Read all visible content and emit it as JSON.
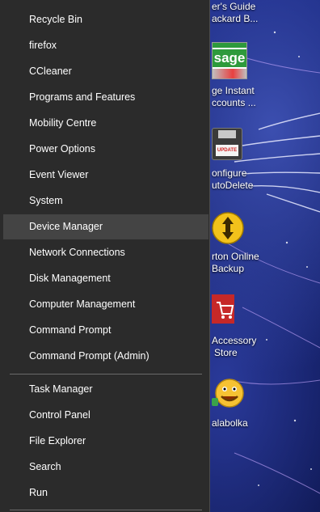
{
  "menu": {
    "group1": [
      {
        "label": "Recycle Bin"
      },
      {
        "label": "firefox"
      },
      {
        "label": "CCleaner"
      },
      {
        "label": "Programs and Features"
      },
      {
        "label": "Mobility Centre"
      },
      {
        "label": "Power Options"
      },
      {
        "label": "Event Viewer"
      },
      {
        "label": "System"
      },
      {
        "label": "Device Manager",
        "highlighted": true
      },
      {
        "label": "Network Connections"
      },
      {
        "label": "Disk Management"
      },
      {
        "label": "Computer Management"
      },
      {
        "label": "Command Prompt"
      },
      {
        "label": "Command Prompt (Admin)"
      }
    ],
    "group2": [
      {
        "label": "Task Manager"
      },
      {
        "label": "Control Panel"
      },
      {
        "label": "File Explorer"
      },
      {
        "label": "Search"
      },
      {
        "label": "Run"
      }
    ]
  },
  "desktop": {
    "icons": [
      {
        "line1": "er's Guide",
        "line2": "ackard B...",
        "icon": "document-icon"
      },
      {
        "line1": "ge Instant",
        "line2": "ccounts ...",
        "icon": "sage-icon",
        "logo_text": "sage"
      },
      {
        "line1": "onfigure",
        "line2": "utoDelete",
        "icon": "floppy-disk-icon",
        "badge_text": "UPDATE"
      },
      {
        "line1": "rton Online",
        "line2": "Backup",
        "icon": "norton-backup-icon"
      },
      {
        "line1": "Accessory",
        "line2": "Store",
        "icon": "shopping-cart-icon"
      },
      {
        "line1": "alabolka",
        "line2": "",
        "icon": "smiley-parrot-icon"
      }
    ]
  },
  "colors": {
    "menu_bg": "#2b2b2b",
    "menu_highlight": "#444444",
    "separator": "#6a6a6a",
    "desktop_bg": "#0d1860"
  }
}
